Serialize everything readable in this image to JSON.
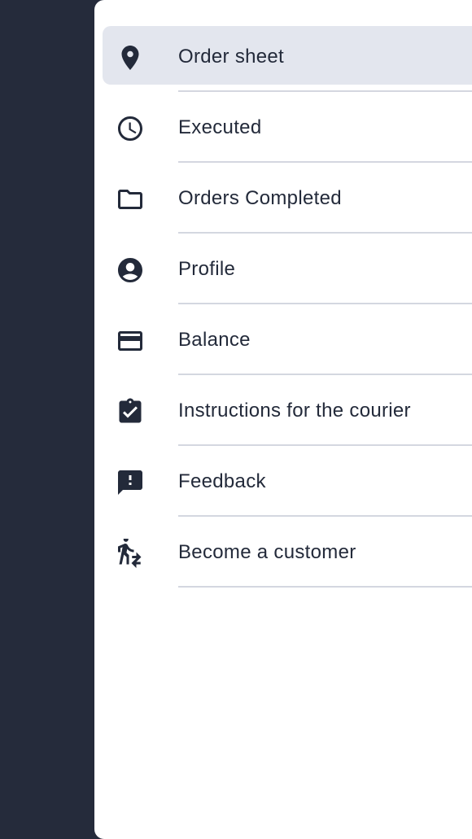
{
  "colors": {
    "scrim": "#252b3b",
    "drawer_bg": "#ffffff",
    "active_bg": "#e3e6ee",
    "text": "#232a3a",
    "divider": "#d4d7e0"
  },
  "menu": {
    "items": [
      {
        "label": "Order sheet",
        "icon": "location-pin-icon",
        "active": true
      },
      {
        "label": "Executed",
        "icon": "clock-icon",
        "active": false
      },
      {
        "label": "Orders Completed",
        "icon": "folder-icon",
        "active": false
      },
      {
        "label": "Profile",
        "icon": "account-circle-icon",
        "active": false
      },
      {
        "label": "Balance",
        "icon": "credit-card-icon",
        "active": false
      },
      {
        "label": "Instructions for the courier",
        "icon": "clipboard-check-icon",
        "active": false
      },
      {
        "label": "Feedback",
        "icon": "feedback-icon",
        "active": false
      },
      {
        "label": "Become a customer",
        "icon": "walker-swap-icon",
        "active": false
      }
    ]
  }
}
